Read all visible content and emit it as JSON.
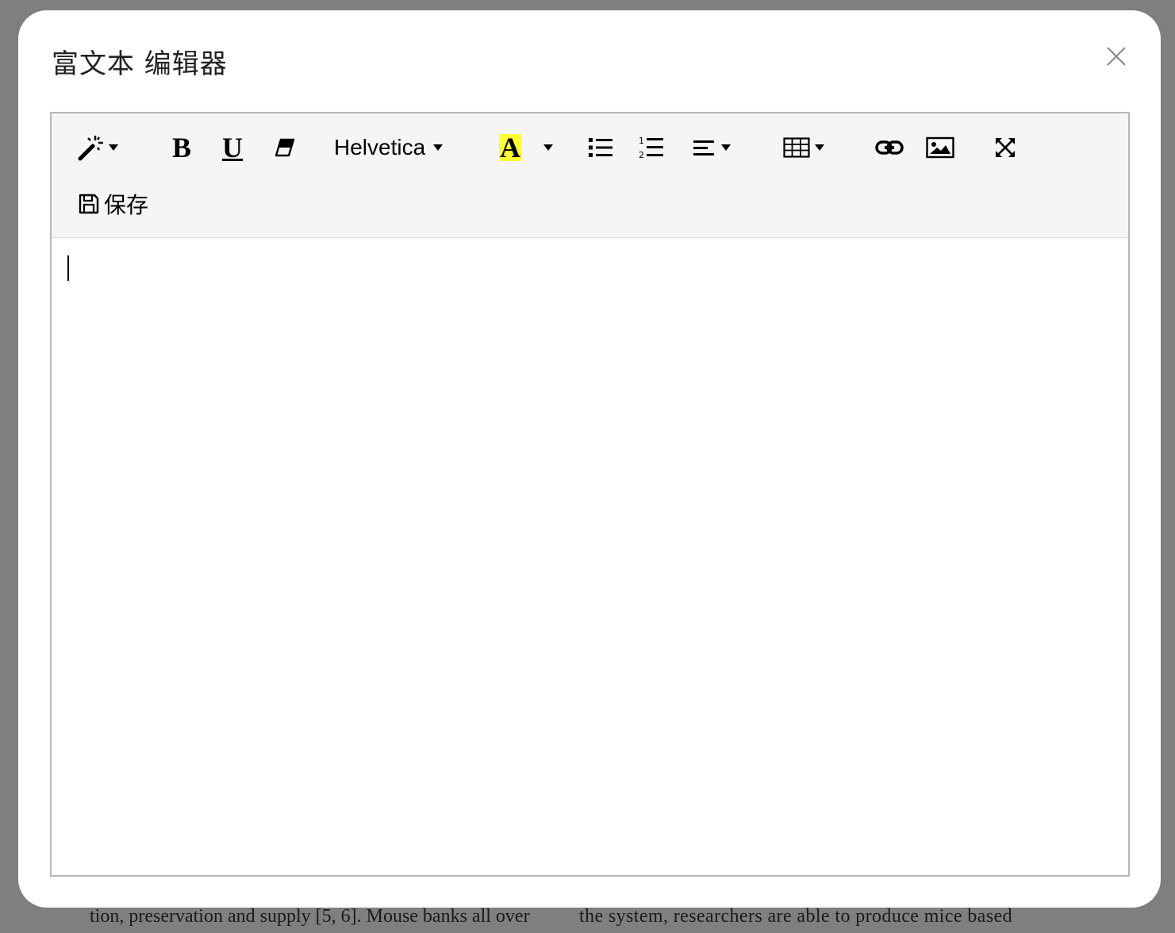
{
  "dialog": {
    "title": "富文本 编辑器",
    "close_icon": "close-icon"
  },
  "toolbar": {
    "style_icon": "magic-wand-icon",
    "bold_label": "B",
    "underline_label": "U",
    "eraser_icon": "eraser-icon",
    "font_name": "Helvetica",
    "color_label": "A",
    "highlight_color": "#ffff33",
    "unordered_list_icon": "unordered-list-icon",
    "ordered_list_icon": "ordered-list-icon",
    "align_icon": "align-left-icon",
    "table_icon": "table-icon",
    "link_icon": "link-icon",
    "image_icon": "image-icon",
    "fullscreen_icon": "fullscreen-icon",
    "save_label": "保存",
    "save_icon": "floppy-disk-icon"
  },
  "editor": {
    "content": ""
  },
  "background_document": {
    "left_line": "tion, preservation and supply [5, 6]. Mouse banks all over",
    "right_line": "the system, researchers are able to produce mice based"
  }
}
